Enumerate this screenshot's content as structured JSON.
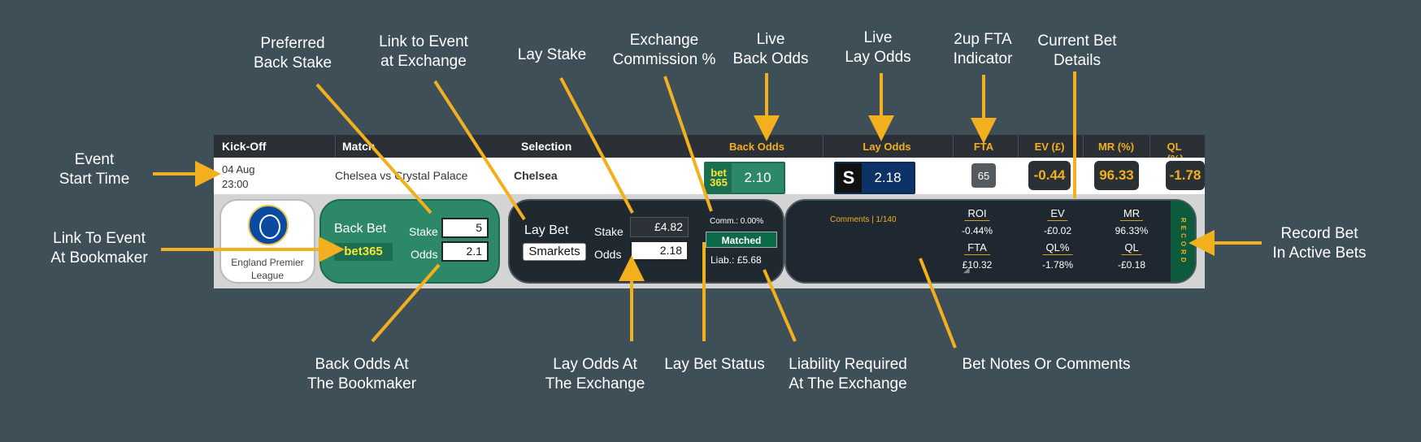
{
  "callouts": {
    "preferred_back_stake": "Preferred\nBack Stake",
    "link_exchange": "Link to Event\nat Exchange",
    "lay_stake": "Lay Stake",
    "commission": "Exchange\nCommission %",
    "live_back": "Live\nBack Odds",
    "live_lay": "Live\nLay Odds",
    "fta_indicator": "2up FTA\nIndicator",
    "current_bet": "Current Bet\nDetails",
    "event_start": "Event\nStart Time",
    "link_bookmaker": "Link To Event\nAt Bookmaker",
    "record_bet": "Record Bet\nIn Active Bets",
    "back_odds_bookmaker": "Back Odds At\nThe Bookmaker",
    "lay_odds_exchange": "Lay Odds At\nThe Exchange",
    "lay_status": "Lay Bet Status",
    "liability": "Liability Required\nAt The Exchange",
    "notes": "Bet Notes Or Comments"
  },
  "header": {
    "kickoff": "Kick-Off",
    "match": "Match",
    "selection": "Selection",
    "back_odds": "Back Odds",
    "lay_odds": "Lay Odds",
    "fta": "FTA",
    "ev": "EV (£)",
    "mr": "MR (%)",
    "ql": "QL (%)"
  },
  "row": {
    "date": "04 Aug",
    "time": "23:00",
    "match": "Chelsea vs Crystal Palace",
    "selection": "Chelsea",
    "back_logo": "bet 365",
    "back_odds": "2.10",
    "lay_logo": "S",
    "lay_odds": "2.18",
    "fta": "65",
    "ev": "-0.44",
    "mr": "96.33",
    "ql": "-1.78"
  },
  "league": {
    "name": "England Premier League"
  },
  "back_bet": {
    "title": "Back Bet",
    "bookmaker": "bet365",
    "stake_label": "Stake",
    "stake": "5",
    "odds_label": "Odds",
    "odds": "2.1"
  },
  "lay_bet": {
    "title": "Lay Bet",
    "exchange": "Smarkets",
    "stake_label": "Stake",
    "stake": "£4.82",
    "odds_label": "Odds",
    "odds": "2.18",
    "commission": "Comm.: 0.00%",
    "status": "Matched",
    "liability": "Liab.: £5.68"
  },
  "stats": {
    "comments": "Comments | 1/140",
    "roi_label": "ROI",
    "roi": "-0.44%",
    "ev_label": "EV",
    "ev": "-£0.02",
    "mr_label": "MR",
    "mr": "96.33%",
    "fta_label": "FTA",
    "fta": "£10.32",
    "qlp_label": "QL%",
    "qlp": "-1.78%",
    "ql_label": "QL",
    "ql": "-£0.18",
    "record": "RECORD"
  },
  "colors": {
    "background": "#3f4f58",
    "accent": "#f2b01e",
    "bet365_green": "#2c8866",
    "exchange_dark": "#202830"
  }
}
